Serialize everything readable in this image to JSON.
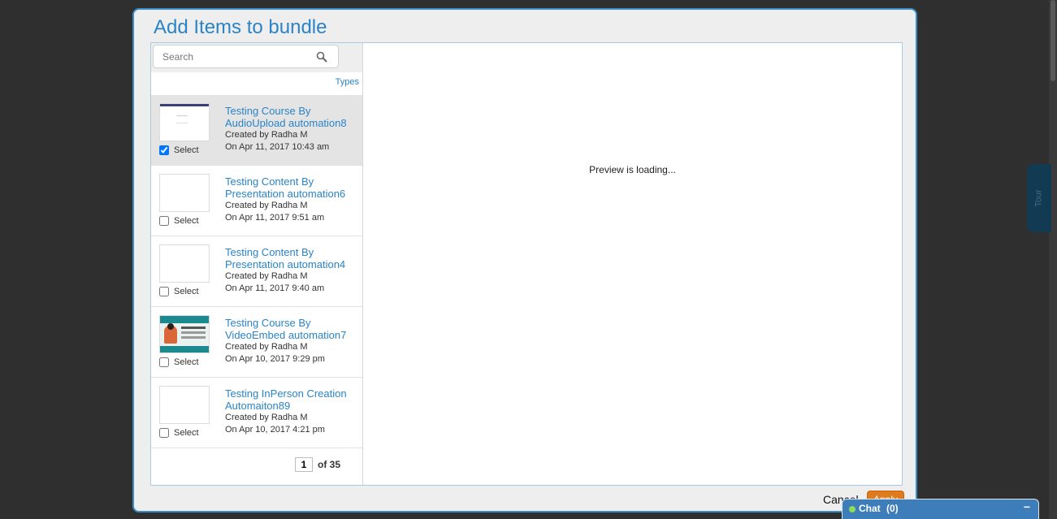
{
  "modal": {
    "title": "Add Items to bundle",
    "search_placeholder": "Search",
    "types_label": "Types",
    "select_label": "Select",
    "items": [
      {
        "title": "Testing Course By AudioUpload automation8",
        "created_by": "Created by Radha M",
        "date": "On Apr 11, 2017 10:43 am",
        "checked": true,
        "thumb": "document-thumbnail"
      },
      {
        "title": "Testing Content By Presentation automation6",
        "created_by": "Created by Radha M",
        "date": "On Apr 11, 2017 9:51 am",
        "checked": false,
        "thumb": "blank-thumbnail"
      },
      {
        "title": "Testing Content By Presentation automation4",
        "created_by": "Created by Radha M",
        "date": "On Apr 11, 2017 9:40 am",
        "checked": false,
        "thumb": "blank-thumbnail"
      },
      {
        "title": "Testing Course By VideoEmbed automation7",
        "created_by": "Created by Radha M",
        "date": "On Apr 10, 2017 9:29 pm",
        "checked": false,
        "thumb": "video-thumbnail"
      },
      {
        "title": "Testing InPerson Creation Automaiton89",
        "created_by": "Created by Radha M",
        "date": "On Apr 10, 2017 4:21 pm",
        "checked": false,
        "thumb": "blank-thumbnail"
      }
    ],
    "pager": {
      "current_page": "1",
      "total_label": "of 35"
    },
    "preview_text": "Preview is loading...",
    "cancel_label": "Cancel",
    "apply_label": "Apply"
  },
  "tour_label": "Tour",
  "chat": {
    "label": "Chat",
    "count": "(0)",
    "minimize_symbol": "−"
  },
  "colors": {
    "accent": "#2a84c6",
    "apply": "#e07a1f",
    "chat": "#3c7dba",
    "selected_row": "#e4e4e4"
  }
}
